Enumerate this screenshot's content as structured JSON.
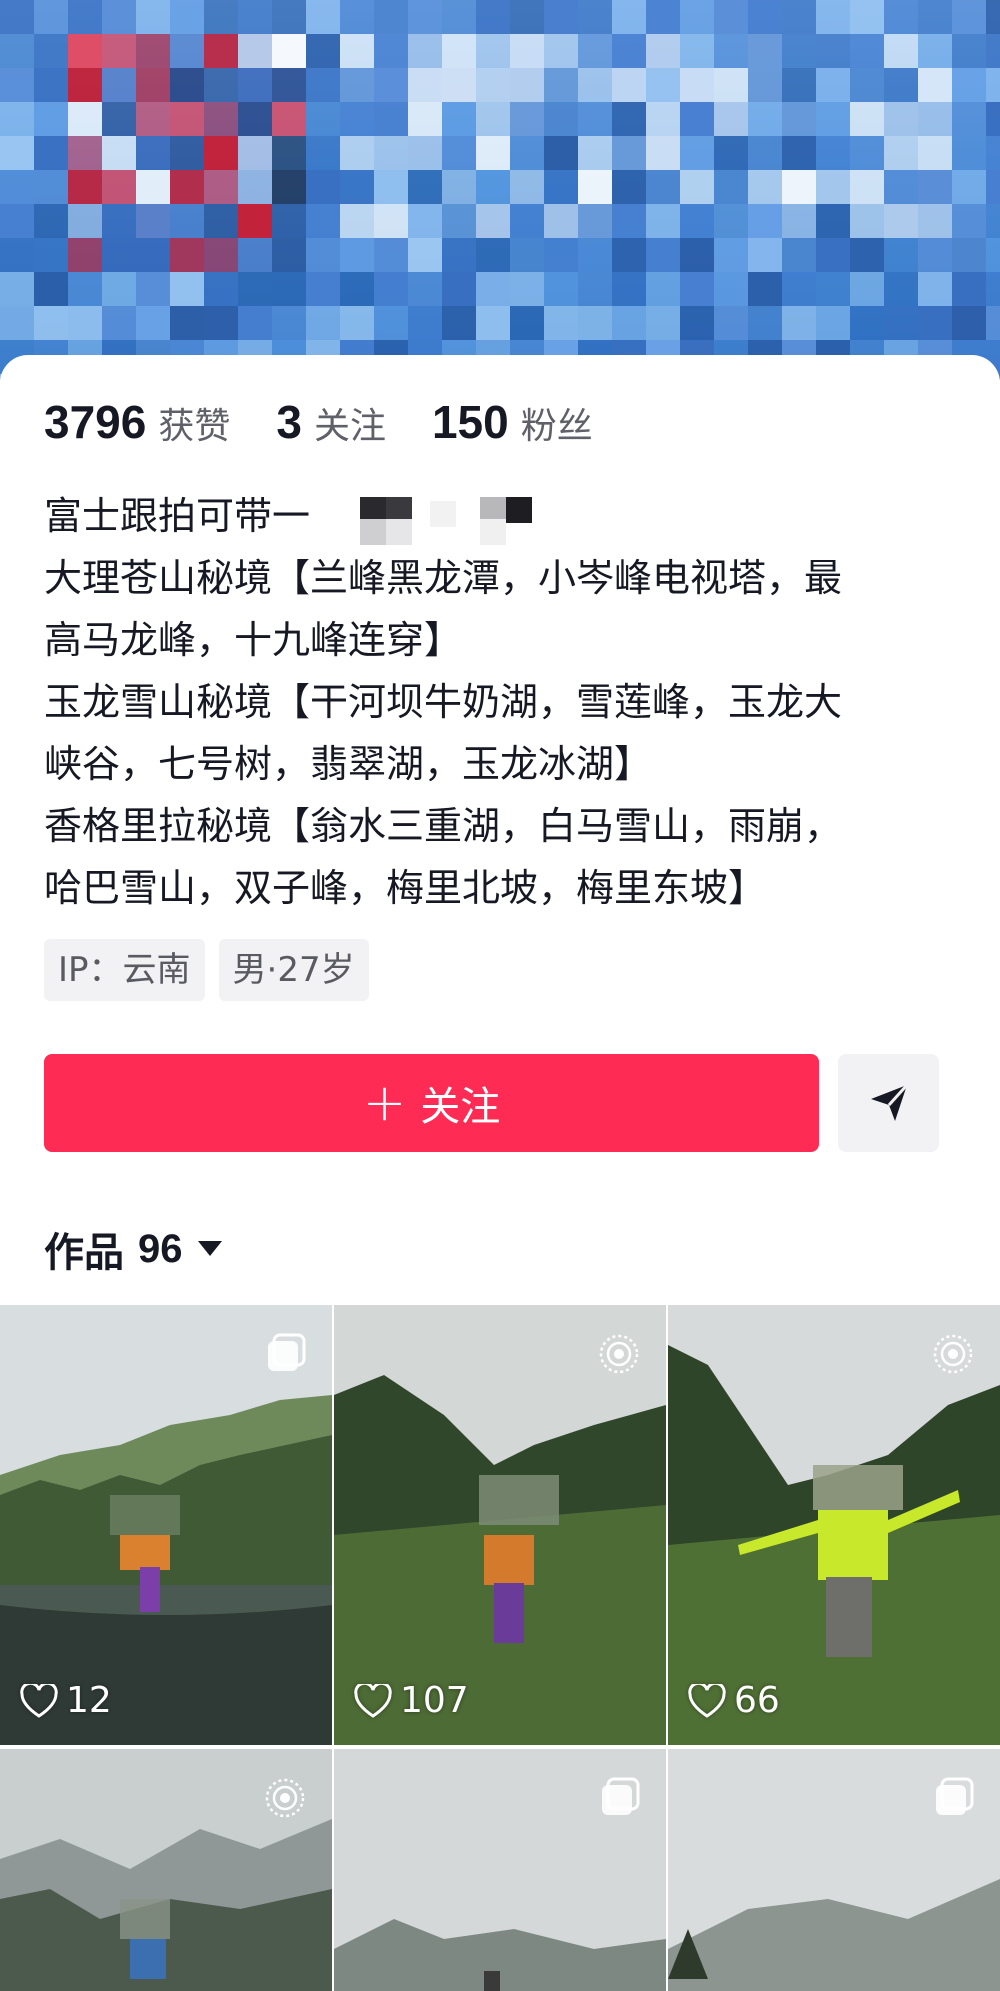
{
  "profile": {
    "stats": [
      {
        "value": "3796",
        "label": "获赞"
      },
      {
        "value": "3",
        "label": "关注"
      },
      {
        "value": "150",
        "label": "粉丝"
      }
    ],
    "bio_lines": [
      "富士跟拍可带一",
      "大理苍山秘境【兰峰黑龙潭，小岑峰电视塔，最",
      "高马龙峰，十九峰连穿】",
      "玉龙雪山秘境【干河坝牛奶湖，雪莲峰，玉龙大",
      "峡谷，七号树，翡翠湖，玉龙冰湖】",
      "香格里拉秘境【翁水三重湖，白马雪山，雨崩，",
      "哈巴雪山，双子峰，梅里北坡，梅里东坡】"
    ],
    "tags": [
      "IP：云南",
      "男·27岁"
    ]
  },
  "actions": {
    "follow_label": "关注",
    "follow_icon": "plus-icon",
    "message_icon": "send-icon"
  },
  "works": {
    "label": "作品",
    "count": "96",
    "caret_icon": "caret-down-icon"
  },
  "grid": {
    "tiles": [
      {
        "likes": "12",
        "badge": "multi-image-icon"
      },
      {
        "likes": "107",
        "badge": "live-photo-icon"
      },
      {
        "likes": "66",
        "badge": "live-photo-icon"
      },
      {
        "likes": "",
        "badge": "live-photo-icon"
      },
      {
        "likes": "",
        "badge": "multi-image-icon"
      },
      {
        "likes": "",
        "badge": "multi-image-icon"
      }
    ]
  },
  "colors": {
    "accent": "#fe2c55",
    "banner": "#3d8bd9",
    "text_primary": "#161823",
    "text_secondary": "#5f6068",
    "tag_bg": "#f2f2f4"
  }
}
